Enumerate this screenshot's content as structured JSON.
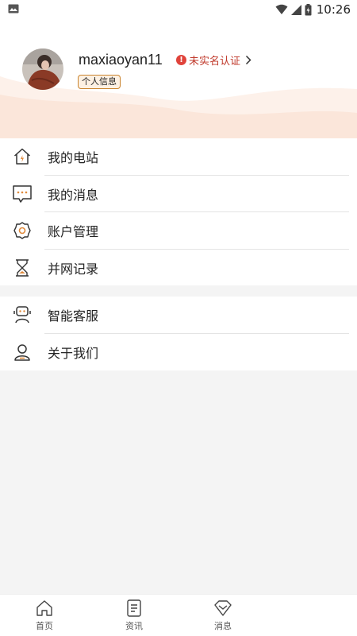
{
  "status_bar": {
    "time": "10:26"
  },
  "profile": {
    "username": "maxiaoyan11",
    "verify_status": "未实名认证",
    "info_tag": "个人信息"
  },
  "menu_group_1": [
    {
      "label": "我的电站",
      "icon": "station-home-icon"
    },
    {
      "label": "我的消息",
      "icon": "message-icon"
    },
    {
      "label": "账户管理",
      "icon": "account-gear-icon"
    },
    {
      "label": "并网记录",
      "icon": "hourglass-icon"
    }
  ],
  "menu_group_2": [
    {
      "label": "智能客服",
      "icon": "robot-service-icon"
    },
    {
      "label": "关于我们",
      "icon": "person-icon"
    }
  ],
  "tab_bar": {
    "tabs": [
      {
        "label": "首页",
        "icon": "home-icon"
      },
      {
        "label": "资讯",
        "icon": "news-icon"
      },
      {
        "label": "消息",
        "icon": "message-diamond-icon"
      }
    ]
  },
  "colors": {
    "accent": "#e0433b",
    "tag_border": "#c9832d",
    "wave": "#fbe9dc",
    "background": "#f4f4f4"
  }
}
